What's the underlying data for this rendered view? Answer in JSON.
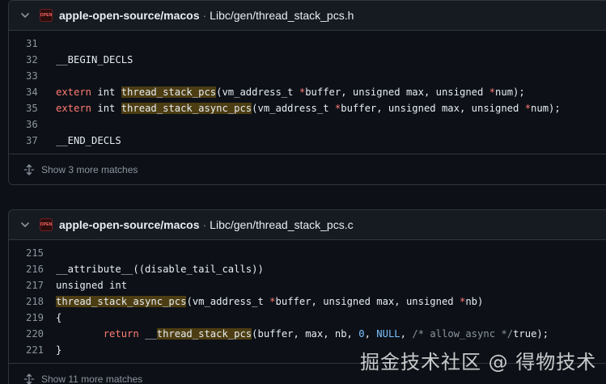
{
  "results": [
    {
      "repo": "apple-open-source/macos",
      "separator": "·",
      "file_path": "Libc/gen/thread_stack_pcs.h",
      "logo_text": "OPEN",
      "lines": [
        {
          "num": "31",
          "segments": []
        },
        {
          "num": "32",
          "segments": [
            {
              "t": "txt",
              "v": "__BEGIN_DECLS"
            }
          ]
        },
        {
          "num": "33",
          "segments": []
        },
        {
          "num": "34",
          "segments": [
            {
              "t": "kw",
              "v": "extern"
            },
            {
              "t": "txt",
              "v": " int "
            },
            {
              "t": "hl",
              "v": "thread_stack_pcs"
            },
            {
              "t": "txt",
              "v": "(vm_address_t "
            },
            {
              "t": "kw",
              "v": "*"
            },
            {
              "t": "txt",
              "v": "buffer, unsigned max, unsigned "
            },
            {
              "t": "kw",
              "v": "*"
            },
            {
              "t": "txt",
              "v": "num);"
            }
          ]
        },
        {
          "num": "35",
          "segments": [
            {
              "t": "kw",
              "v": "extern"
            },
            {
              "t": "txt",
              "v": " int "
            },
            {
              "t": "hl",
              "v": "thread_stack_async_pcs"
            },
            {
              "t": "txt",
              "v": "(vm_address_t "
            },
            {
              "t": "kw",
              "v": "*"
            },
            {
              "t": "txt",
              "v": "buffer, unsigned max, unsigned "
            },
            {
              "t": "kw",
              "v": "*"
            },
            {
              "t": "txt",
              "v": "num);"
            }
          ]
        },
        {
          "num": "36",
          "segments": []
        },
        {
          "num": "37",
          "segments": [
            {
              "t": "txt",
              "v": "__END_DECLS"
            }
          ]
        }
      ],
      "more_label": "Show 3 more matches"
    },
    {
      "repo": "apple-open-source/macos",
      "separator": "·",
      "file_path": "Libc/gen/thread_stack_pcs.c",
      "logo_text": "OPEN",
      "lines": [
        {
          "num": "215",
          "segments": []
        },
        {
          "num": "216",
          "segments": [
            {
              "t": "txt",
              "v": "__attribute__((disable_tail_calls))"
            }
          ]
        },
        {
          "num": "217",
          "segments": [
            {
              "t": "txt",
              "v": "unsigned int"
            }
          ]
        },
        {
          "num": "218",
          "segments": [
            {
              "t": "hl",
              "v": "thread_stack_async_pcs"
            },
            {
              "t": "txt",
              "v": "(vm_address_t "
            },
            {
              "t": "kw",
              "v": "*"
            },
            {
              "t": "txt",
              "v": "buffer, unsigned max, unsigned "
            },
            {
              "t": "kw",
              "v": "*"
            },
            {
              "t": "txt",
              "v": "nb)"
            }
          ]
        },
        {
          "num": "219",
          "segments": [
            {
              "t": "txt",
              "v": "{"
            }
          ]
        },
        {
          "num": "220",
          "segments": [
            {
              "t": "txt",
              "v": "        "
            },
            {
              "t": "kw",
              "v": "return"
            },
            {
              "t": "txt",
              "v": " __"
            },
            {
              "t": "hl",
              "v": "thread_stack_pcs"
            },
            {
              "t": "txt",
              "v": "(buffer, max, nb, "
            },
            {
              "t": "const",
              "v": "0"
            },
            {
              "t": "txt",
              "v": ", "
            },
            {
              "t": "const",
              "v": "NULL"
            },
            {
              "t": "txt",
              "v": ", "
            },
            {
              "t": "cmt",
              "v": "/* allow_async */"
            },
            {
              "t": "txt",
              "v": "true);"
            }
          ]
        },
        {
          "num": "221",
          "segments": [
            {
              "t": "txt",
              "v": "}"
            }
          ]
        }
      ],
      "more_label": "Show 11 more matches"
    }
  ],
  "watermark": "掘金技术社区 @ 得物技术",
  "colors": {
    "background": "#0d1117",
    "header": "#161b22",
    "border": "#30363d",
    "keyword": "#ff7b72",
    "constant": "#79c0ff",
    "highlight": "#4d3d12"
  }
}
